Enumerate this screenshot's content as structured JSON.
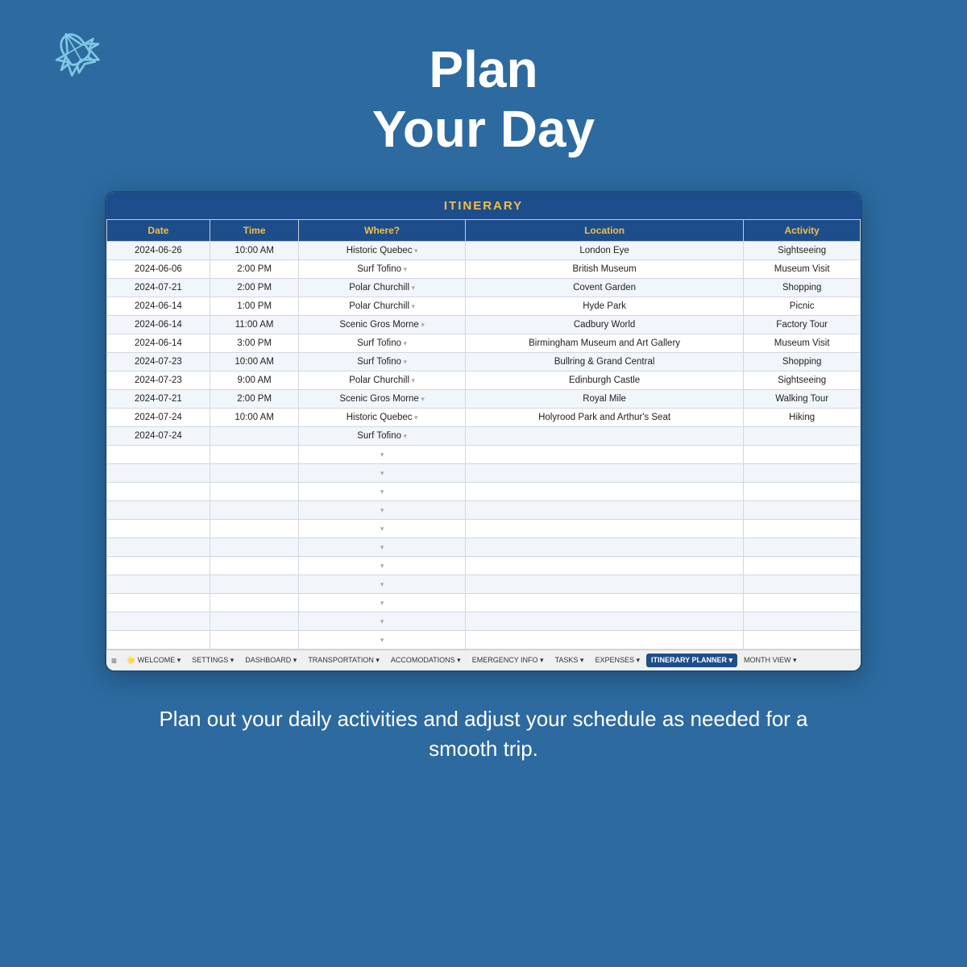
{
  "header": {
    "title_line1": "Plan",
    "title_line2": "Your Day"
  },
  "footer_text": "Plan out your daily activities and adjust your schedule as needed for a smooth trip.",
  "spreadsheet": {
    "title": "ITINERARY",
    "columns": [
      "Date",
      "Time",
      "Where?",
      "Location",
      "Activity"
    ],
    "rows": [
      {
        "date": "2024-06-26",
        "time": "10:00 AM",
        "where": "Historic Quebec",
        "location": "London Eye",
        "activity": "Sightseeing"
      },
      {
        "date": "2024-06-06",
        "time": "2:00 PM",
        "where": "Surf Tofino",
        "location": "British Museum",
        "activity": "Museum Visit"
      },
      {
        "date": "2024-07-21",
        "time": "2:00 PM",
        "where": "Polar Churchill",
        "location": "Covent Garden",
        "activity": "Shopping"
      },
      {
        "date": "2024-06-14",
        "time": "1:00 PM",
        "where": "Polar Churchill",
        "location": "Hyde Park",
        "activity": "Picnic"
      },
      {
        "date": "2024-06-14",
        "time": "11:00 AM",
        "where": "Scenic Gros Morne",
        "location": "Cadbury World",
        "activity": "Factory Tour"
      },
      {
        "date": "2024-06-14",
        "time": "3:00 PM",
        "where": "Surf Tofino",
        "location": "Birmingham Museum and Art Gallery",
        "activity": "Museum Visit"
      },
      {
        "date": "2024-07-23",
        "time": "10:00 AM",
        "where": "Surf Tofino",
        "location": "Bullring & Grand Central",
        "activity": "Shopping"
      },
      {
        "date": "2024-07-23",
        "time": "9:00 AM",
        "where": "Polar Churchill",
        "location": "Edinburgh Castle",
        "activity": "Sightseeing"
      },
      {
        "date": "2024-07-21",
        "time": "2:00 PM",
        "where": "Scenic Gros Morne",
        "location": "Royal Mile",
        "activity": "Walking Tour"
      },
      {
        "date": "2024-07-24",
        "time": "10:00 AM",
        "where": "Historic Quebec",
        "location": "Holyrood Park and Arthur's Seat",
        "activity": "Hiking"
      },
      {
        "date": "2024-07-24",
        "time": "",
        "where": "Surf Tofino",
        "location": "",
        "activity": ""
      },
      {
        "date": "",
        "time": "",
        "where": "",
        "location": "",
        "activity": ""
      },
      {
        "date": "",
        "time": "",
        "where": "",
        "location": "",
        "activity": ""
      },
      {
        "date": "",
        "time": "",
        "where": "",
        "location": "",
        "activity": ""
      },
      {
        "date": "",
        "time": "",
        "where": "",
        "location": "",
        "activity": ""
      },
      {
        "date": "",
        "time": "",
        "where": "",
        "location": "",
        "activity": ""
      },
      {
        "date": "",
        "time": "",
        "where": "",
        "location": "",
        "activity": ""
      },
      {
        "date": "",
        "time": "",
        "where": "",
        "location": "",
        "activity": ""
      },
      {
        "date": "",
        "time": "",
        "where": "",
        "location": "",
        "activity": ""
      },
      {
        "date": "",
        "time": "",
        "where": "",
        "location": "",
        "activity": ""
      },
      {
        "date": "",
        "time": "",
        "where": "",
        "location": "",
        "activity": ""
      },
      {
        "date": "",
        "time": "",
        "where": "",
        "location": "",
        "activity": ""
      }
    ],
    "tabs": [
      {
        "label": "≡",
        "type": "menu"
      },
      {
        "label": "🌟 WELCOME",
        "active": false
      },
      {
        "label": "SETTINGS",
        "active": false
      },
      {
        "label": "DASHBOARD",
        "active": false
      },
      {
        "label": "TRANSPORTATION",
        "active": false
      },
      {
        "label": "ACCOMODATIONS",
        "active": false
      },
      {
        "label": "EMERGENCY INFO",
        "active": false
      },
      {
        "label": "TASKS",
        "active": false
      },
      {
        "label": "EXPENSES",
        "active": false
      },
      {
        "label": "ITINERARY PLANNER",
        "active": true
      },
      {
        "label": "MONTH VIEW",
        "active": false
      }
    ]
  }
}
